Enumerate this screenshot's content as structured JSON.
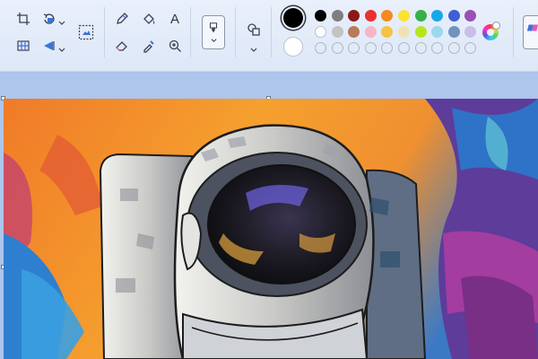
{
  "ribbon": {
    "tools": [
      {
        "name": "crop-icon"
      },
      {
        "name": "rotate-icon"
      },
      {
        "name": "resize-icon"
      },
      {
        "name": "flip-icon"
      },
      {
        "name": "select-icon"
      },
      {
        "name": "pencil-icon"
      },
      {
        "name": "fill-icon"
      },
      {
        "name": "text-icon"
      },
      {
        "name": "eraser-icon"
      },
      {
        "name": "color-picker-icon"
      },
      {
        "name": "magnifier-icon"
      },
      {
        "name": "brush-icon"
      },
      {
        "name": "shapes-icon"
      }
    ],
    "text_tool_glyph": "A"
  },
  "colors": {
    "primary": "#000000",
    "secondary": "#ffffff",
    "palette_row1": [
      "#000000",
      "#7f7f7f",
      "#8b1a1a",
      "#e83131",
      "#f58a1f",
      "#fde233",
      "#37b04a",
      "#18a8e8",
      "#3f5fd6",
      "#9b4fb5"
    ],
    "palette_row2": [
      "#ffffff",
      "#c3c3c3",
      "#b97a57",
      "#f5b6c8",
      "#f5c242",
      "#efe4b0",
      "#b5e61d",
      "#99d9ea",
      "#7092be",
      "#c8bfe7"
    ],
    "palette_row3_empty_count": 10
  }
}
